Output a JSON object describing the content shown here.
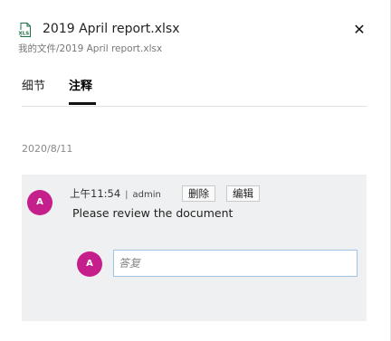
{
  "file": {
    "icon": "excel-file-icon",
    "icon_label": "XLS",
    "icon_color": "#1e7145",
    "name": "2019 April report.xlsx",
    "path_root": "我的文件",
    "path_sep": "/",
    "path_file": "2019 April report.xlsx"
  },
  "header": {
    "close_icon": "✕"
  },
  "tabs": [
    {
      "label": "细节",
      "active": false
    },
    {
      "label": "注释",
      "active": true
    }
  ],
  "comments": {
    "date": "2020/8/11",
    "items": [
      {
        "avatar_initial": "A",
        "avatar_color": "#c51f8b",
        "time_prefix": "上午",
        "time": "11:54",
        "separator": "|",
        "author": "admin",
        "delete_label": "删除",
        "edit_label": "编辑",
        "text": "Please review the document"
      }
    ],
    "reply": {
      "avatar_initial": "A",
      "placeholder": "答复"
    }
  }
}
